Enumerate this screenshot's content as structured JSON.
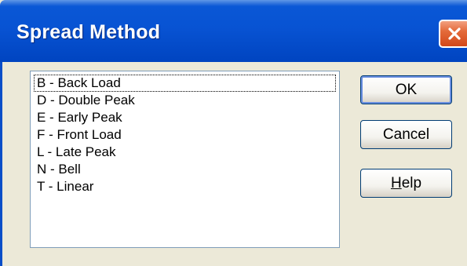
{
  "dialog": {
    "title": "Spread Method",
    "close_icon": "close-icon",
    "accent_color": "#0a58d6",
    "close_color": "#e46a3a"
  },
  "list": {
    "items": [
      "B - Back Load",
      "D - Double Peak",
      "E - Early Peak",
      "F - Front Load",
      "L - Late Peak",
      "N - Bell",
      "T - Linear"
    ],
    "focused_index": 0
  },
  "buttons": {
    "ok_label": "OK",
    "cancel_label": "Cancel",
    "help_mnemonic": "H",
    "help_rest": "elp"
  }
}
